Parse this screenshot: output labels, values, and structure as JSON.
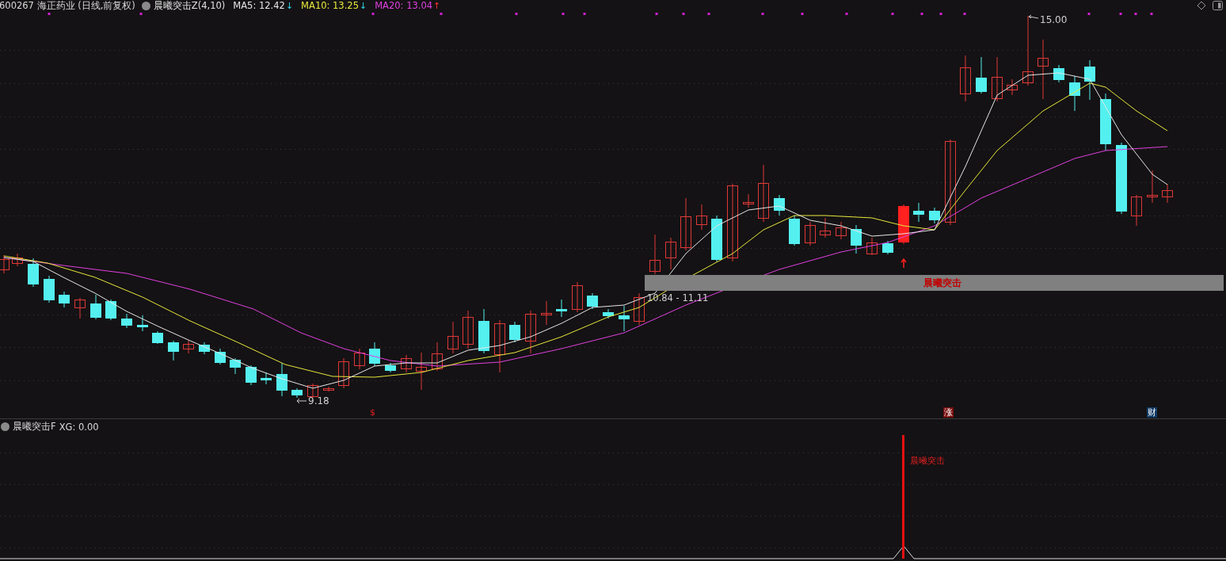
{
  "header": {
    "stock": "600267 海正药业 (日线,前复权)",
    "indicator": "晨曦突击Z(4,10)",
    "averages": [
      {
        "label": "MA5: 12.42",
        "arrow": "↓",
        "rising": false,
        "color": "#e6e6e6"
      },
      {
        "label": "MA10: 13.25",
        "arrow": "↓",
        "rising": false,
        "color": "#e8e83c"
      },
      {
        "label": "MA20: 13.04",
        "arrow": "↑",
        "rising": true,
        "color": "#e040e0"
      }
    ]
  },
  "main_chart": {
    "high_label": "15.00",
    "low_label": "9.18",
    "band": {
      "label": "晨曦突击",
      "range": "10.84 - 11.11"
    },
    "markers": [
      {
        "text": "$",
        "kind": "plain"
      },
      {
        "text": "涨",
        "kind": "up"
      },
      {
        "text": "财",
        "kind": "finance"
      }
    ]
  },
  "sub_chart": {
    "title": "晨曦突击F",
    "value": "XG: 0.00",
    "signal_label": "晨曦突击"
  }
}
